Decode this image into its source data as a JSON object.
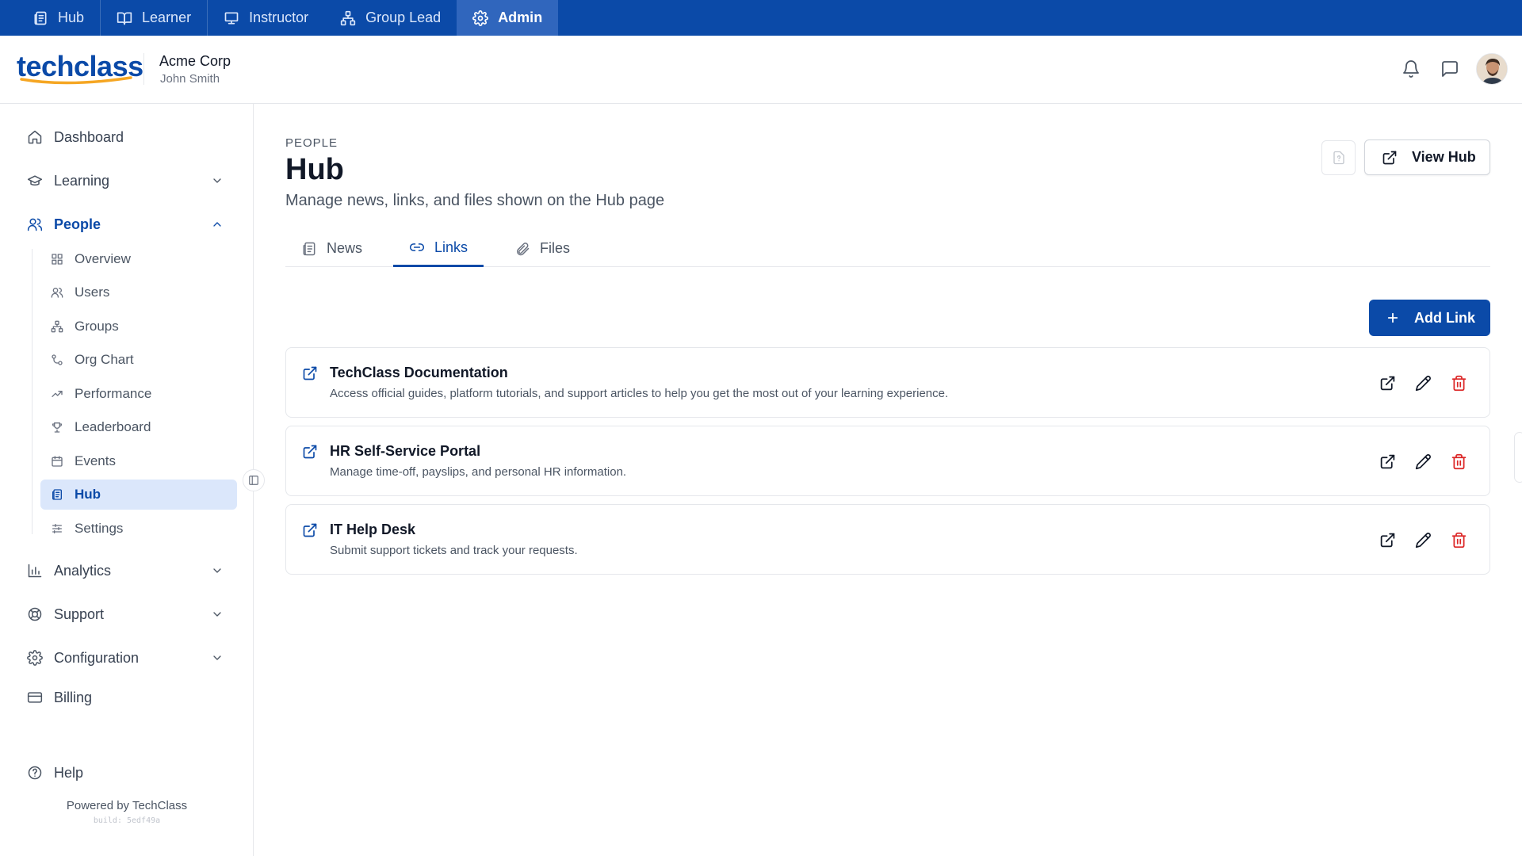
{
  "rolebar": {
    "roles": [
      {
        "label": "Hub",
        "icon": "newspaper-icon"
      },
      {
        "label": "Learner",
        "icon": "book-icon"
      },
      {
        "label": "Instructor",
        "icon": "presentation-icon"
      },
      {
        "label": "Group Lead",
        "icon": "org-icon"
      },
      {
        "label": "Admin",
        "icon": "gear-icon",
        "active": true
      }
    ]
  },
  "header": {
    "logo_text": "techclass",
    "org_name": "Acme Corp",
    "user_name": "John Smith"
  },
  "sidebar": {
    "dashboard": "Dashboard",
    "learning": "Learning",
    "people": "People",
    "people_items": [
      "Overview",
      "Users",
      "Groups",
      "Org Chart",
      "Performance",
      "Leaderboard",
      "Events",
      "Hub",
      "Settings"
    ],
    "active_item": "Hub",
    "analytics": "Analytics",
    "support": "Support",
    "configuration": "Configuration",
    "billing": "Billing",
    "help": "Help",
    "powered_by": "Powered by TechClass",
    "build": "build: 5edf49a"
  },
  "page": {
    "eyebrow": "PEOPLE",
    "title": "Hub",
    "description": "Manage news, links, and files shown on the Hub page",
    "view_hub_label": "View Hub"
  },
  "tabs": [
    {
      "label": "News",
      "icon": "newspaper-icon"
    },
    {
      "label": "Links",
      "icon": "link-icon",
      "active": true
    },
    {
      "label": "Files",
      "icon": "paperclip-icon"
    }
  ],
  "add_link_label": "Add Link",
  "links": [
    {
      "title": "TechClass Documentation",
      "description": "Access official guides, platform tutorials, and support articles to help you get the most out of your learning experience."
    },
    {
      "title": "HR Self-Service Portal",
      "description": "Manage time-off, payslips, and personal HR information."
    },
    {
      "title": "IT Help Desk",
      "description": "Submit support tickets and track your requests."
    }
  ],
  "colors": {
    "brand": "#0b4aa8",
    "brand_light": "#dbe7fb",
    "logo_accent": "#f5a623",
    "danger": "#dc2626"
  }
}
